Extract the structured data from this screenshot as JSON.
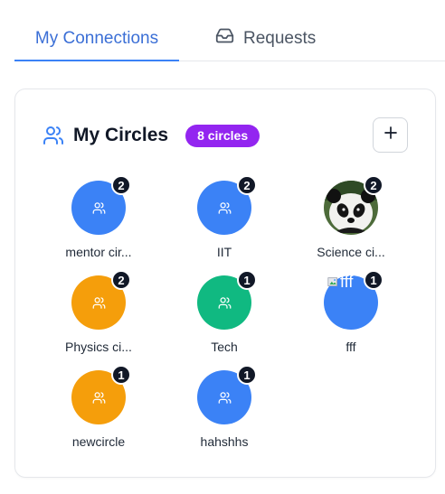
{
  "tabs": [
    {
      "label": "My Connections",
      "active": true
    },
    {
      "label": "Requests",
      "icon": "inbox-icon",
      "active": false
    }
  ],
  "circles_card": {
    "title": "My Circles",
    "icon": "users-icon",
    "badge": "8 circles",
    "add_icon": "plus-icon",
    "colors": {
      "blue": "#3b82f6",
      "orange": "#f59e0b",
      "green": "#10b981",
      "badge": "#9325f0"
    },
    "items": [
      {
        "name": "mentor cir...",
        "count": "2",
        "color": "#3b82f6",
        "image": "none"
      },
      {
        "name": "IIT",
        "count": "2",
        "color": "#3b82f6",
        "image": "none"
      },
      {
        "name": "Science ci...",
        "count": "2",
        "color": "#ffffff",
        "image": "panda-photo"
      },
      {
        "name": "Physics ci...",
        "count": "2",
        "color": "#f59e0b",
        "image": "none"
      },
      {
        "name": "Tech",
        "count": "1",
        "color": "#10b981",
        "image": "none"
      },
      {
        "name": "fff",
        "count": "1",
        "color": "#3b82f6",
        "image": "broken-image",
        "image_alt": "fff"
      },
      {
        "name": "newcircle",
        "count": "1",
        "color": "#f59e0b",
        "image": "none"
      },
      {
        "name": "hahshhs",
        "count": "1",
        "color": "#3b82f6",
        "image": "none"
      }
    ]
  }
}
